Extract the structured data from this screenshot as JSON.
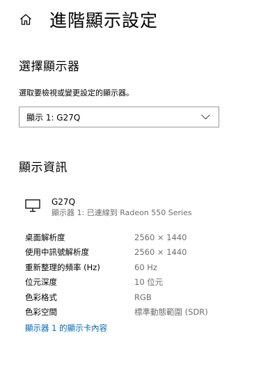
{
  "header": {
    "title": "進階顯示設定"
  },
  "select_display": {
    "heading": "選擇顯示器",
    "prompt": "選取要檢視或變更設定的顯示器。",
    "selected": "顯示 1: G27Q"
  },
  "display_info": {
    "heading": "顯示資訊",
    "monitor_name": "G27Q",
    "monitor_subtitle": "顯示器 1: 已連線到 Radeon 550 Series",
    "rows": [
      {
        "label": "桌面解析度",
        "value": "2560 × 1440"
      },
      {
        "label": "使用中訊號解析度",
        "value": "2560 × 1440"
      },
      {
        "label": "重新整理的頻率 (Hz)",
        "value": "60 Hz"
      },
      {
        "label": "位元深度",
        "value": "10 位元"
      },
      {
        "label": "色彩格式",
        "value": "RGB"
      },
      {
        "label": "色彩空間",
        "value": "標準動態範圍 (SDR)"
      }
    ],
    "adapter_link": "顯示器 1 的顯示卡內容"
  },
  "colors": {
    "link": "#0066b4",
    "secondary_text": "#6d6d6d",
    "dropdown_border": "#999999"
  },
  "icons": {
    "home": "home-icon",
    "dropdown": "chevron-down-icon",
    "monitor": "monitor-icon"
  }
}
